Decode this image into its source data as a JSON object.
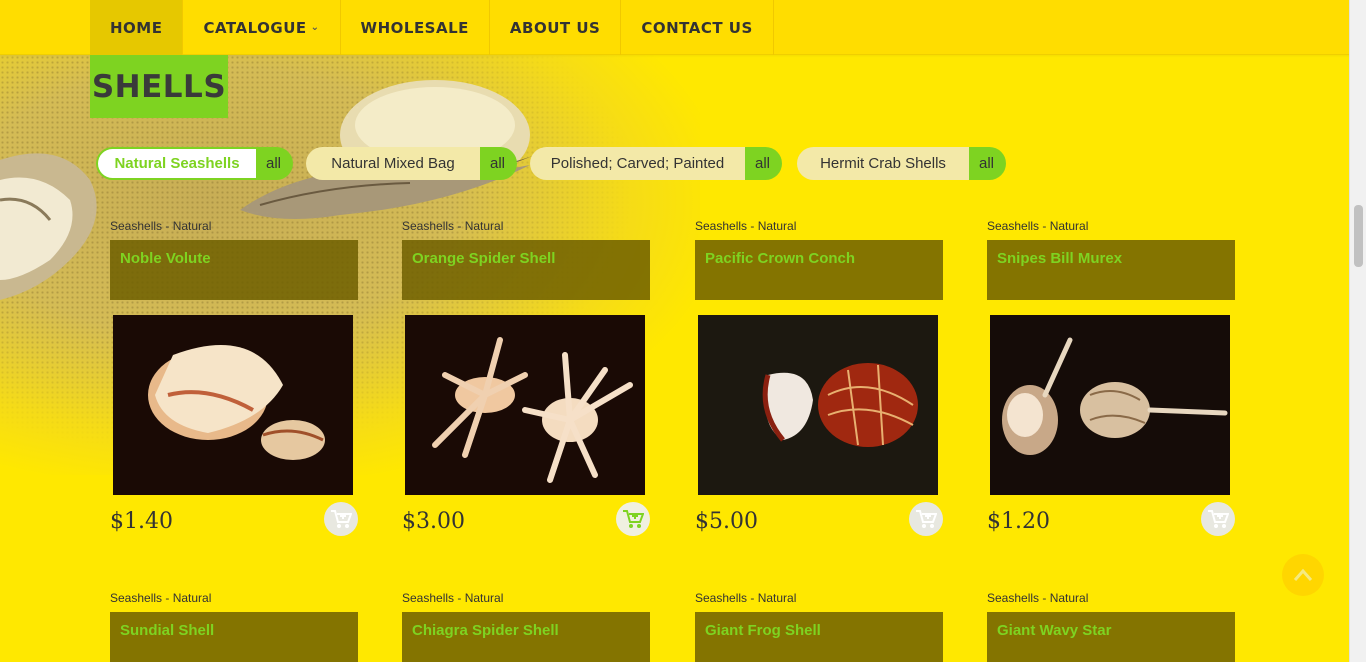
{
  "nav": {
    "items": [
      {
        "label": "HOME"
      },
      {
        "label": "CATALOGUE"
      },
      {
        "label": "WHOLESALE"
      },
      {
        "label": "ABOUT US"
      },
      {
        "label": "CONTACT US"
      }
    ]
  },
  "page": {
    "title": "SHELLS"
  },
  "filters": [
    {
      "label": "Natural Seashells",
      "all": "all",
      "active": true
    },
    {
      "label": "Natural Mixed Bag",
      "all": "all"
    },
    {
      "label": "Polished; Carved; Painted",
      "all": "all"
    },
    {
      "label": "Hermit Crab Shells",
      "all": "all"
    }
  ],
  "products": [
    {
      "category": "Seashells - Natural",
      "name": "Noble Volute",
      "price": "$1.40"
    },
    {
      "category": "Seashells - Natural",
      "name": "Orange Spider Shell",
      "price": "$3.00"
    },
    {
      "category": "Seashells - Natural",
      "name": "Pacific Crown Conch",
      "price": "$5.00"
    },
    {
      "category": "Seashells - Natural",
      "name": "Snipes Bill Murex",
      "price": "$1.20"
    },
    {
      "category": "Seashells - Natural",
      "name": "Sundial Shell"
    },
    {
      "category": "Seashells - Natural",
      "name": "Chiagra Spider Shell"
    },
    {
      "category": "Seashells - Natural",
      "name": "Giant Frog Shell"
    },
    {
      "category": "Seashells - Natural",
      "name": "Giant Wavy Star"
    }
  ],
  "colors": {
    "background": "#ffe800",
    "accent_green": "#7ed321",
    "name_box": "#6e5f00"
  },
  "icons": {
    "cart": "cart-icon",
    "catalogue_caret": "chevron-down-icon",
    "back_to_top": "chevron-up-icon"
  }
}
